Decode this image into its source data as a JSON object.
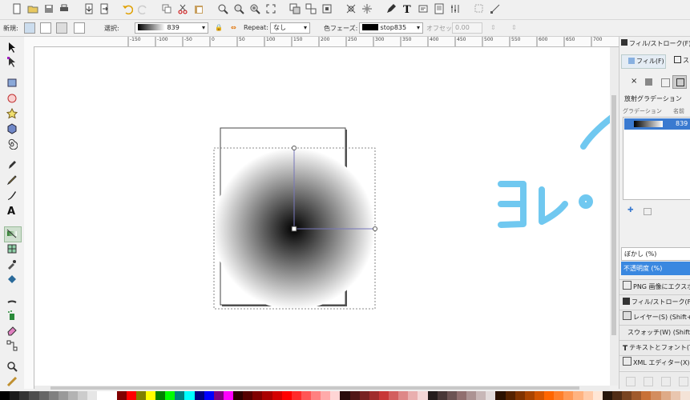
{
  "toolbar": {
    "mode_label": "新規:",
    "select_label": "選択:",
    "gradient_name": "839",
    "repeat_label": "Repeat:",
    "repeat_value": "なし",
    "stops_label": "色フェーズ:",
    "stop_value": "stop835",
    "offset_label": "オフセット:",
    "offset_value": "0.00"
  },
  "ruler": {
    "ticks": [
      "-150",
      "-100",
      "-50",
      "0",
      "50",
      "100",
      "150",
      "200",
      "250",
      "300",
      "350",
      "400",
      "450",
      "500",
      "550",
      "600",
      "650",
      "700"
    ]
  },
  "panel": {
    "title": "フィル/ストローク(F) (Shift",
    "tab_fill": "フィル(F)",
    "tab_stroke": "ス",
    "gradient_type": "放射グラデーション",
    "col_gradient": "グラデーション",
    "col_name": "名前",
    "gradient_entry": "839",
    "blur_label": "ぼかし (%)",
    "opacity_label": "不透明度 (%)",
    "docks": [
      "PNG 画像にエクスポート",
      "フィル/ストローク(F) (Shift",
      "レイヤー(S) (Shift+Ctrl",
      "スウォッチ(W) (Shift+",
      "テキストとフォント(T) (S",
      "XML エディター(X) (Shift"
    ]
  },
  "annotation": {
    "text": "コレ。",
    "color": "#70c8f0"
  },
  "palette_colors": [
    "#000000",
    "#1a1a1a",
    "#333333",
    "#4d4d4d",
    "#666666",
    "#808080",
    "#999999",
    "#b3b3b3",
    "#cccccc",
    "#e6e6e6",
    "#ffffff",
    "#ffffff",
    "#800000",
    "#ff0000",
    "#808000",
    "#ffff00",
    "#008000",
    "#00ff00",
    "#008080",
    "#00ffff",
    "#000080",
    "#0000ff",
    "#800080",
    "#ff00ff",
    "#2b0000",
    "#550000",
    "#800000",
    "#aa0000",
    "#d40000",
    "#ff0000",
    "#ff2a2a",
    "#ff5555",
    "#ff8080",
    "#ffaaaa",
    "#ffd5d5",
    "#280b0b",
    "#501616",
    "#782121",
    "#a02c2c",
    "#c83737",
    "#d35f5f",
    "#de8787",
    "#e9afaf",
    "#f4d7d7",
    "#241c1c",
    "#483737",
    "#6c5353",
    "#916f6f",
    "#ac9393",
    "#c8b7b7",
    "#e3dbdb",
    "#2b1100",
    "#552200",
    "#803300",
    "#aa4400",
    "#d45500",
    "#ff6600",
    "#ff7f2a",
    "#ff9955",
    "#ffb380",
    "#ffccaa",
    "#ffe6d5",
    "#28170b",
    "#502d16",
    "#784421",
    "#a05a2c",
    "#c87137",
    "#d38d5f",
    "#deaa87",
    "#e9c6af",
    "#f4e3d7"
  ]
}
